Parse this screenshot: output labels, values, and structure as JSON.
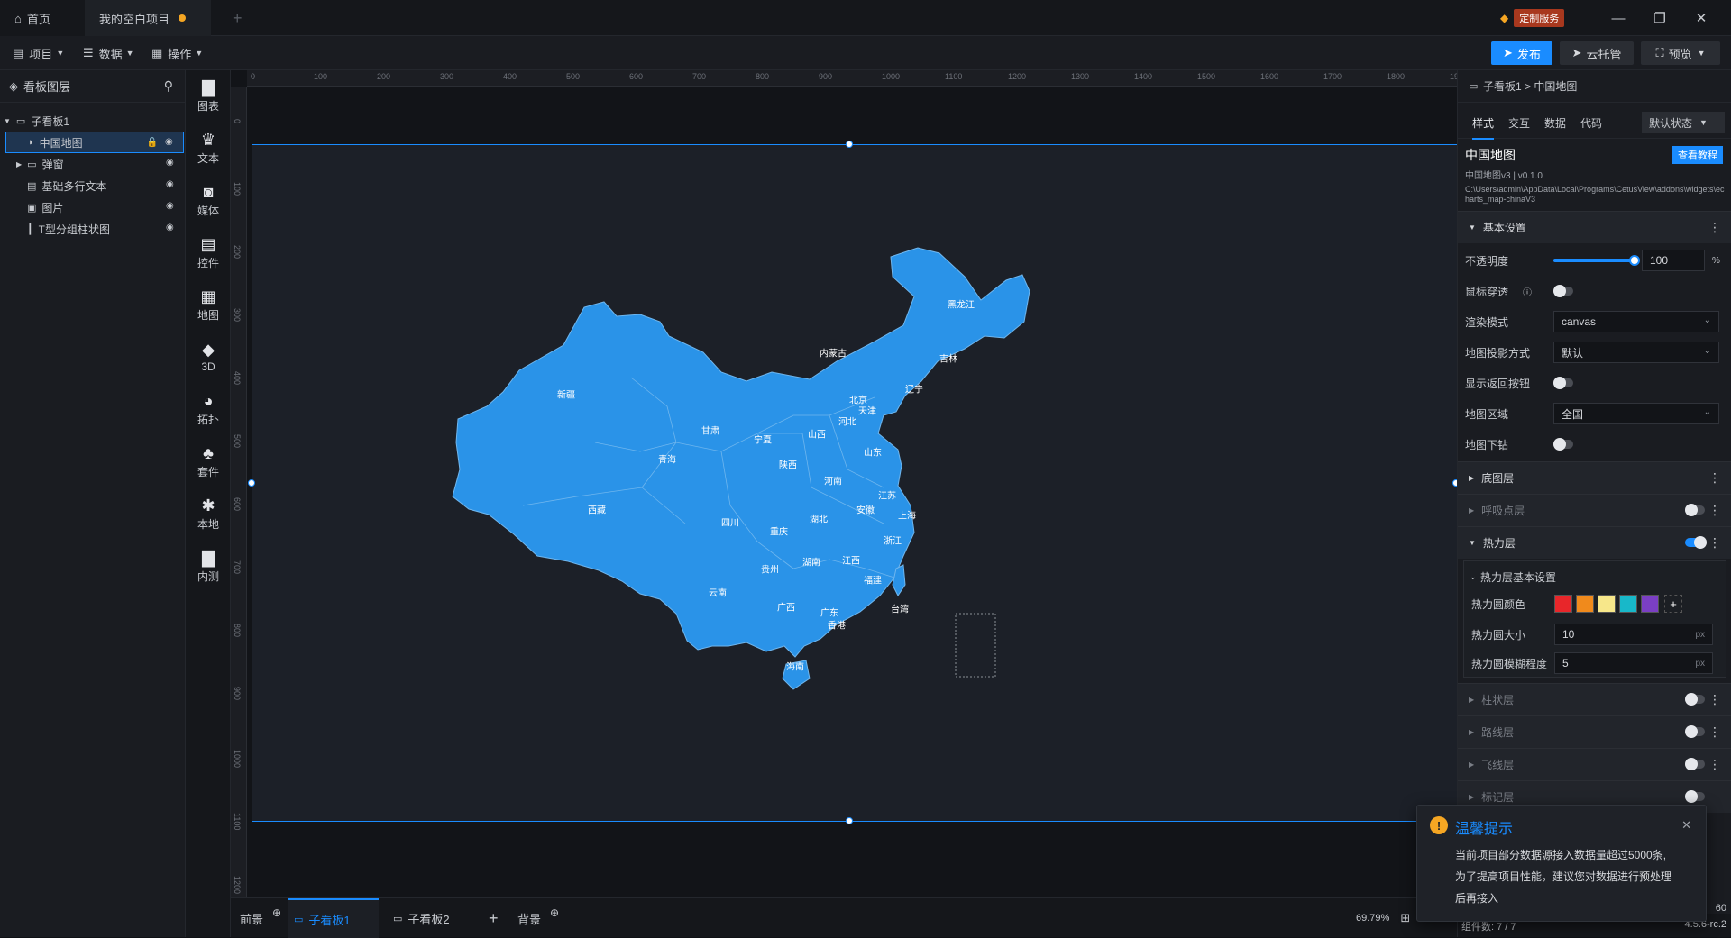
{
  "titlebar": {
    "home_tab": "首页",
    "project_tab": "我的空白项目",
    "custom_service": "定制服务"
  },
  "toolbar": {
    "project": "项目",
    "data": "数据",
    "operate": "操作",
    "publish": "发布",
    "cloud_host": "云托管",
    "preview": "预览"
  },
  "layers": {
    "title": "看板图层",
    "items": [
      {
        "label": "子看板1"
      },
      {
        "label": "中国地图"
      },
      {
        "label": "弹窗"
      },
      {
        "label": "基础多行文本"
      },
      {
        "label": "图片"
      },
      {
        "label": "T型分组柱状图"
      }
    ]
  },
  "components": [
    {
      "label": "图表"
    },
    {
      "label": "文本"
    },
    {
      "label": "媒体"
    },
    {
      "label": "控件"
    },
    {
      "label": "地图"
    },
    {
      "label": "3D"
    },
    {
      "label": "拓扑"
    },
    {
      "label": "套件"
    },
    {
      "label": "本地"
    },
    {
      "label": "内测"
    }
  ],
  "ruler": {
    "h_ticks": [
      "0",
      "100",
      "200",
      "300",
      "400",
      "500",
      "600",
      "700",
      "800",
      "900",
      "1000",
      "1100",
      "1200",
      "1300",
      "1400",
      "1500",
      "1600",
      "1700",
      "1800",
      "1900"
    ],
    "v_ticks": [
      "0",
      "100",
      "200",
      "300",
      "400",
      "500",
      "600",
      "700",
      "800",
      "900",
      "1000",
      "1100",
      "1200"
    ]
  },
  "map": {
    "provinces": [
      "黑龙江",
      "吉林",
      "辽宁",
      "内蒙古",
      "北京",
      "天津",
      "河北",
      "山西",
      "山东",
      "宁夏",
      "甘肃",
      "陕西",
      "新疆",
      "青海",
      "西藏",
      "四川",
      "重庆",
      "河南",
      "江苏",
      "安徽",
      "上海",
      "湖北",
      "浙江",
      "湖南",
      "江西",
      "福建",
      "贵州",
      "云南",
      "广西",
      "广东",
      "香港",
      "台湾",
      "海南"
    ]
  },
  "bottom": {
    "foreground": "前景",
    "board1": "子看板1",
    "board2": "子看板2",
    "background": "背景",
    "zoom": "69.79%",
    "components_count": "组件数: 7 / 7",
    "version": "4.5.6-rc.2",
    "partial_num": "60"
  },
  "props": {
    "breadcrumb": "子看板1 > 中国地图",
    "tabs": [
      "样式",
      "交互",
      "数据",
      "代码"
    ],
    "state": "默认状态",
    "widget_name": "中国地图",
    "widget_version": "中国地图v3 | v0.1.0",
    "widget_path": "C:\\Users\\admin\\AppData\\Local\\Programs\\CetusView\\addons\\widgets\\echarts_map-chinaV3",
    "tutorial": "查看教程",
    "basic_section": "基本设置",
    "opacity_label": "不透明度",
    "opacity_value": "100",
    "opacity_unit": "%",
    "opacity": 1.0,
    "mouse_through": "鼠标穿透",
    "render_mode_label": "渲染模式",
    "render_mode": "canvas",
    "projection_label": "地图投影方式",
    "projection": "默认",
    "back_button": "显示返回按钮",
    "region_label": "地图区域",
    "region": "全国",
    "drill": "地图下钻",
    "base_layer": "底图层",
    "breath_layer": "呼吸点层",
    "heat_layer": "热力层",
    "heat_basic": "热力层基本设置",
    "heat_color_label": "热力圆颜色",
    "heat_colors": [
      "#e8262a",
      "#f08a1c",
      "#f7e78a",
      "#18b8c9",
      "#7b3fc4"
    ],
    "heat_size_label": "热力圆大小",
    "heat_size": "10",
    "heat_blur_label": "热力圆模糊程度",
    "heat_blur": "5",
    "unit_px": "px",
    "bar_layer": "柱状层",
    "route_layer": "路线层",
    "fly_layer": "飞线层",
    "label_layer": "标记层"
  },
  "toast": {
    "title": "温馨提示",
    "line1": "当前项目部分数据源接入数据量超过5000条,",
    "line2": "为了提高项目性能，建议您对数据进行预处理",
    "line3": "后再接入"
  },
  "colors": {
    "accent": "#1a8cff",
    "map_fill": "#2a93e8"
  }
}
